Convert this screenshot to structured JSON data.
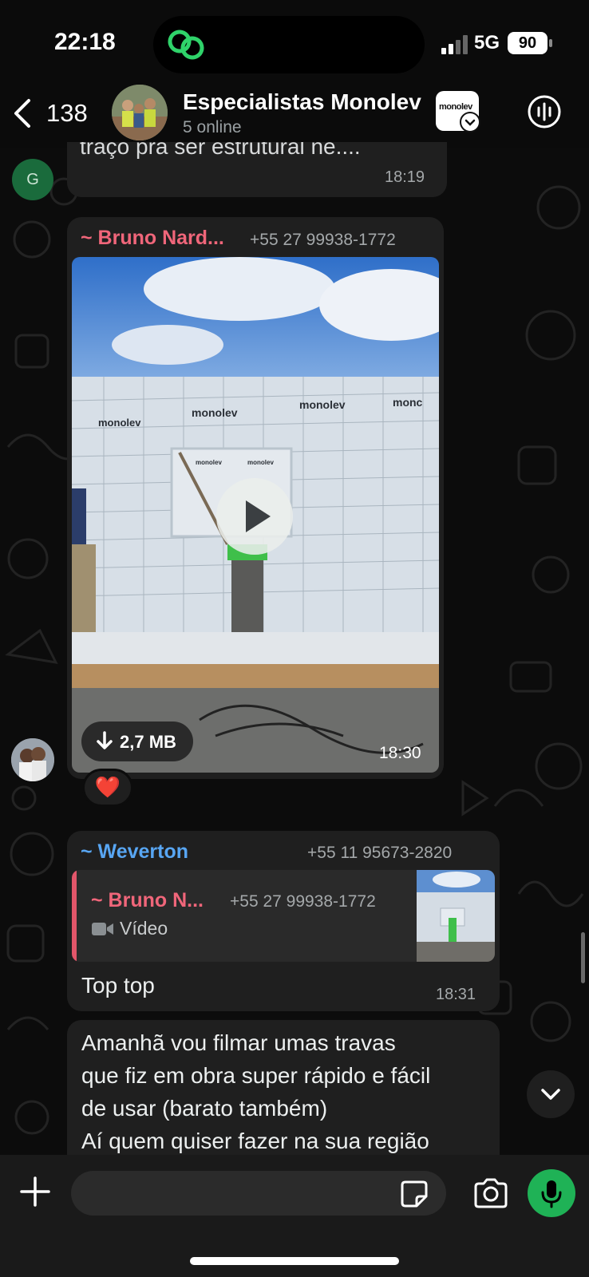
{
  "status_bar": {
    "time": "22:18",
    "network": "5G",
    "battery": "90"
  },
  "header": {
    "back_count": "138",
    "title": "Especialistas Monolev",
    "subtitle": "5 online",
    "logo_text": "monolev"
  },
  "messages": [
    {
      "partial_text": "traço pra ser estrutural né....",
      "time": "18:19",
      "avatar_initial": "G"
    },
    {
      "sender": "~ Bruno Nard...",
      "phone": "+55 27 99938-1772",
      "video_size": "2,7 MB",
      "time": "18:30",
      "reaction": "❤️",
      "wall_labels": [
        "monolev",
        "monolev",
        "monolev",
        "monc",
        "monolev",
        "monolev"
      ]
    },
    {
      "sender": "~ Weverton",
      "phone": "+55 11 95673-2820",
      "quote_sender": "~ Bruno N...",
      "quote_phone": "+55 27 99938-1772",
      "quote_type": "Vídeo",
      "text": "Top top",
      "time": "18:31"
    },
    {
      "lines": [
        "Amanhã vou filmar umas travas",
        "que fiz em obra super rápido e fácil",
        "de usar (barato também)",
        "Aí quem quiser fazer na sua região"
      ]
    }
  ],
  "colors": {
    "sender_bruno": "#f0667a",
    "sender_weverton": "#58a6f3",
    "mic_button": "#1fb256",
    "bubble": "#1f1f1f"
  },
  "icons": [
    "back-chevron-icon",
    "call-waveform-icon",
    "play-icon",
    "download-icon",
    "video-camera-icon",
    "chevron-down-icon",
    "plus-icon",
    "sticker-icon",
    "camera-icon",
    "microphone-icon"
  ]
}
